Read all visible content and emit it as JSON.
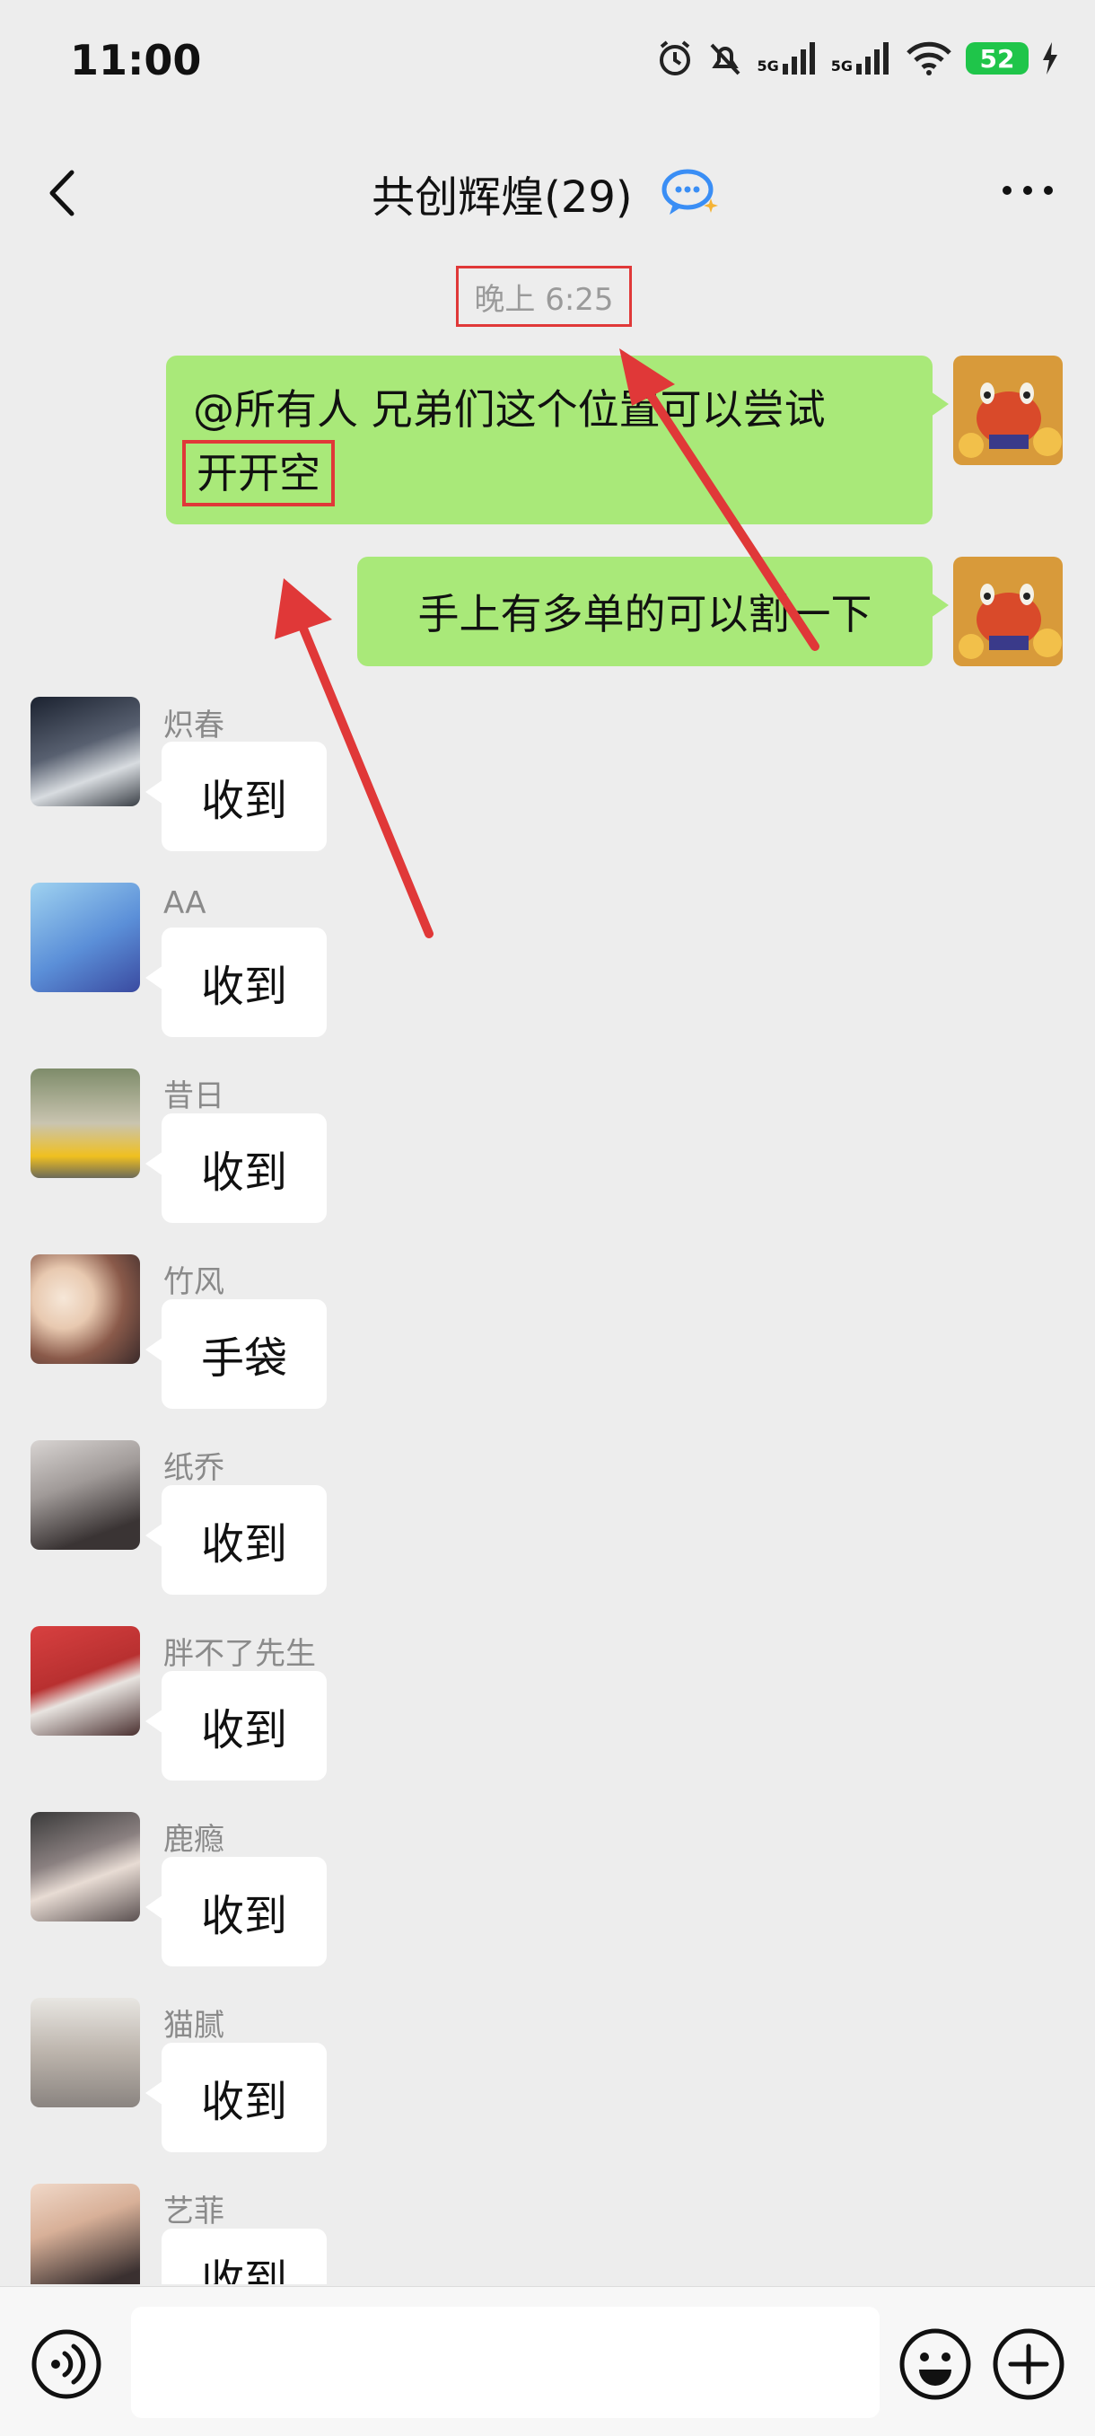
{
  "status_bar": {
    "time": "11:00",
    "network_1": "5G",
    "network_2": "5G",
    "battery": "52"
  },
  "header": {
    "title": "共创辉煌(29)"
  },
  "timestamp": "晚上 6:25",
  "outgoing_messages": [
    {
      "line1": "@所有人 兄弟们这个位置可以尝试",
      "highlight": "开开空"
    },
    {
      "text": "手上有多单的可以割一下"
    }
  ],
  "incoming_messages": [
    {
      "name": "炽春",
      "text": "收到"
    },
    {
      "name": "AA",
      "text": "收到"
    },
    {
      "name": "昔日",
      "text": "收到"
    },
    {
      "name": "竹风",
      "text": "手袋"
    },
    {
      "name": "纸乔",
      "text": "收到"
    },
    {
      "name": "胖不了先生",
      "text": "收到"
    },
    {
      "name": "鹿瘾",
      "text": "收到"
    },
    {
      "name": "猫腻",
      "text": "收到"
    },
    {
      "name": "艺菲",
      "text": "收到"
    }
  ],
  "input": {
    "placeholder": ""
  },
  "colors": {
    "outgoing_bubble": "#a9e979",
    "annotation_red": "#e03838",
    "background": "#ededed"
  }
}
